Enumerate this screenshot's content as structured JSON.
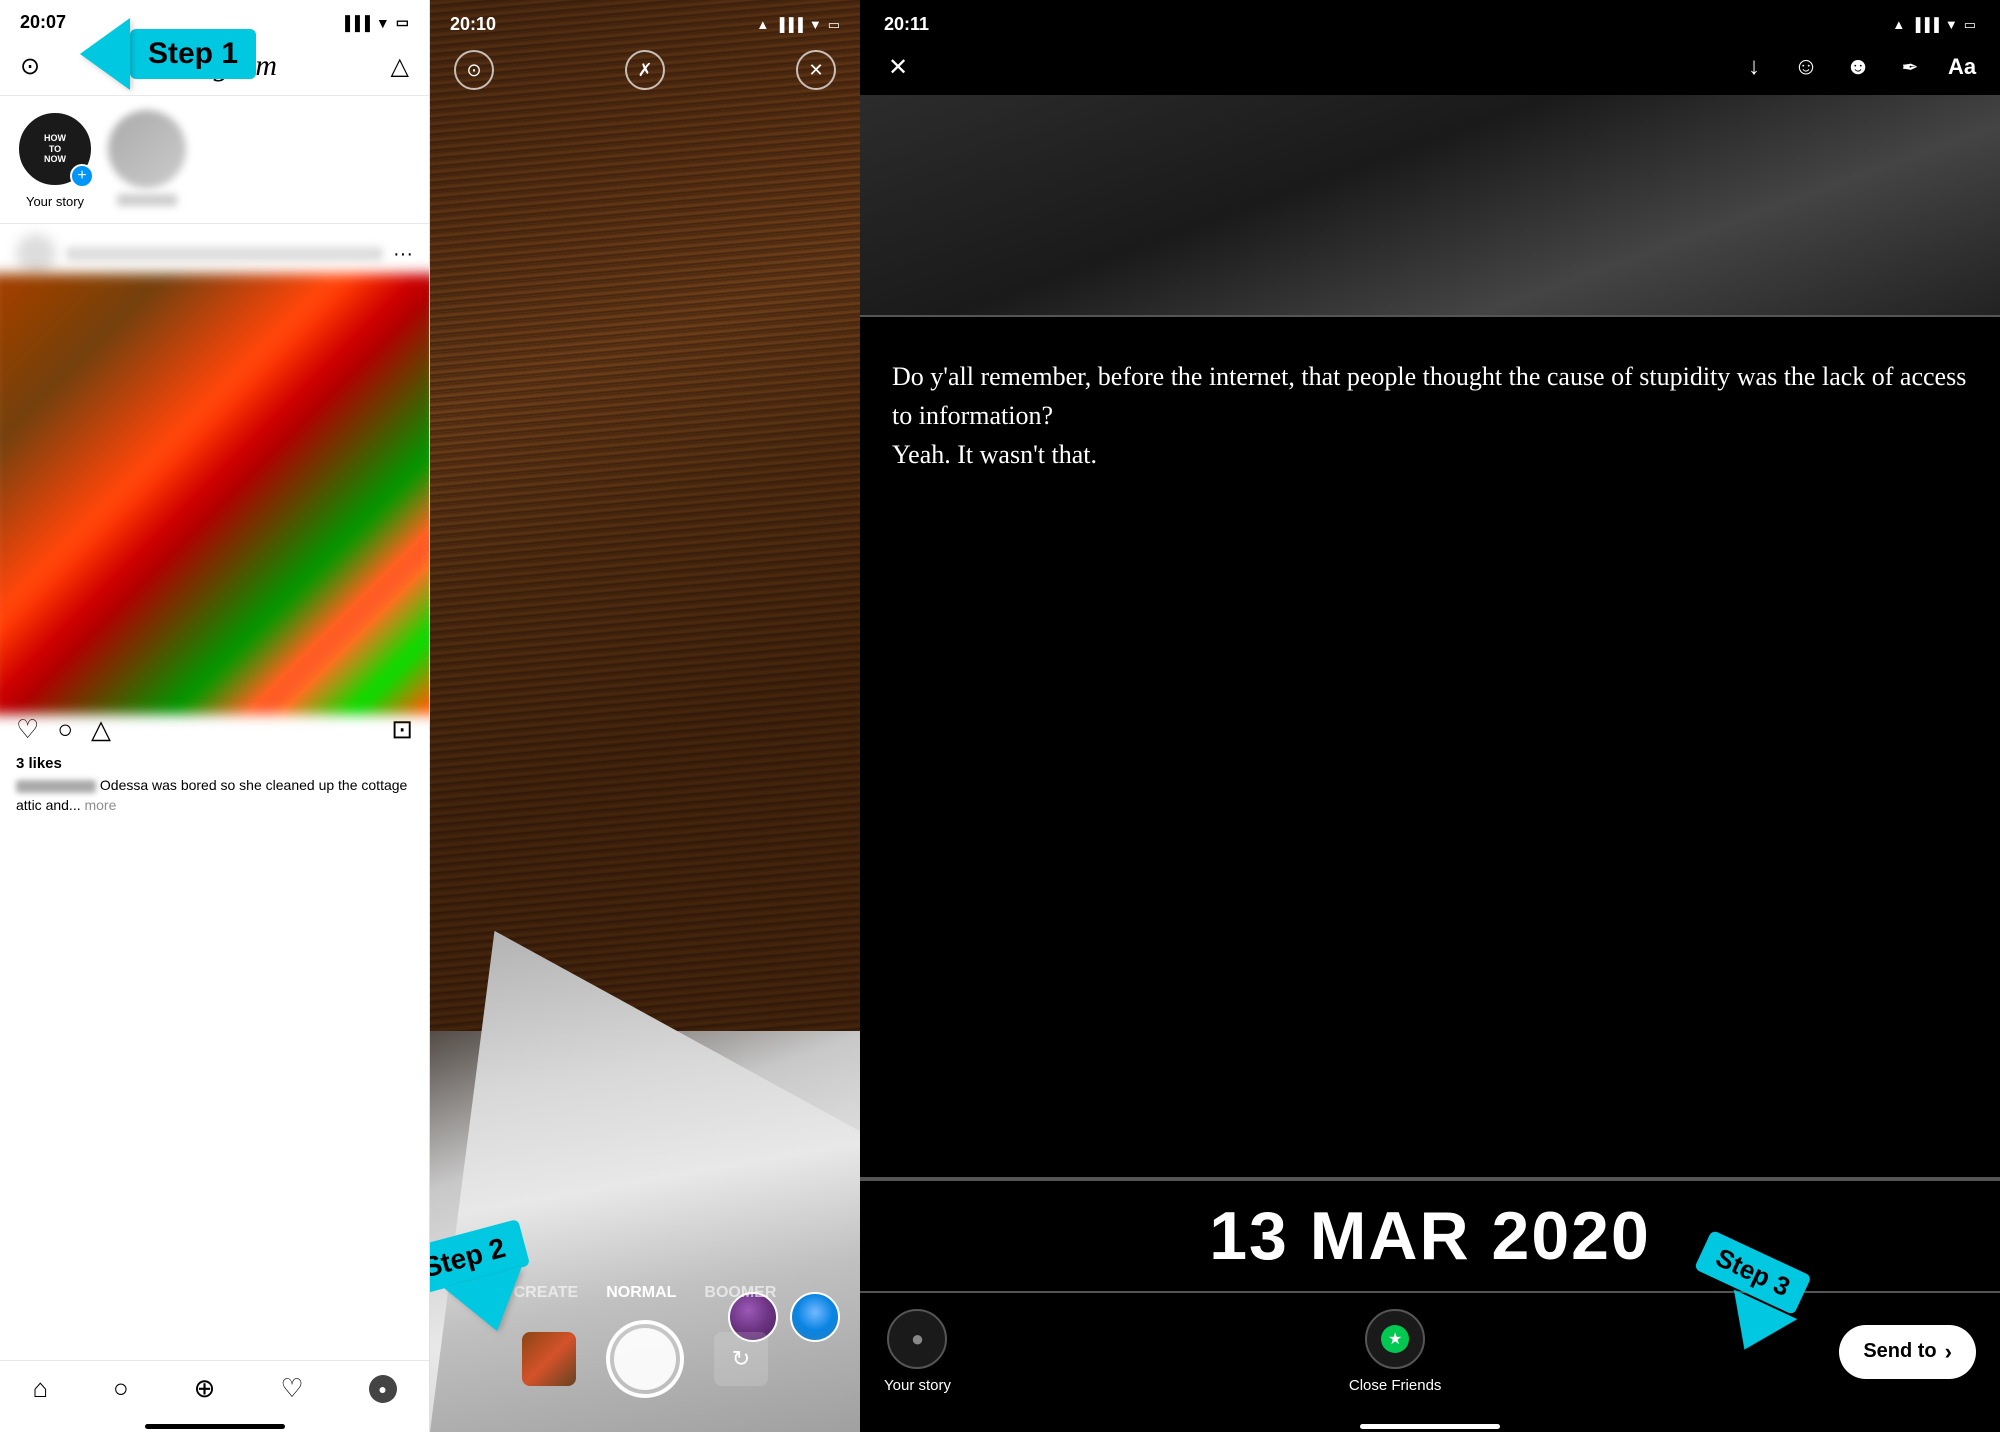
{
  "phone1": {
    "status_time": "20:07",
    "app_name": "Instagram",
    "story_label": "Your story",
    "step1_text": "Step 1",
    "likes": "3 likes",
    "caption_text": "Odessa was bored so she cleaned up the cottage attic and...",
    "caption_more": "more",
    "nav_items": [
      "home",
      "search",
      "add",
      "heart",
      "profile"
    ]
  },
  "phone2": {
    "status_time": "20:10",
    "step2_text": "Step 2",
    "modes": [
      "CREATE",
      "NORMAL",
      "BOOMER"
    ]
  },
  "phone3": {
    "status_time": "20:11",
    "quote_text": "Do y'all remember, before the internet, that people thought the cause of stupidity was the lack of access to information?\nYeah.  It wasn't that.",
    "date_text": "13 MAR 2020",
    "story_dest1": "Your story",
    "story_dest2": "Close Friends",
    "send_to_label": "Send to",
    "send_to_chevron": "›",
    "step3_text": "Step 3"
  }
}
